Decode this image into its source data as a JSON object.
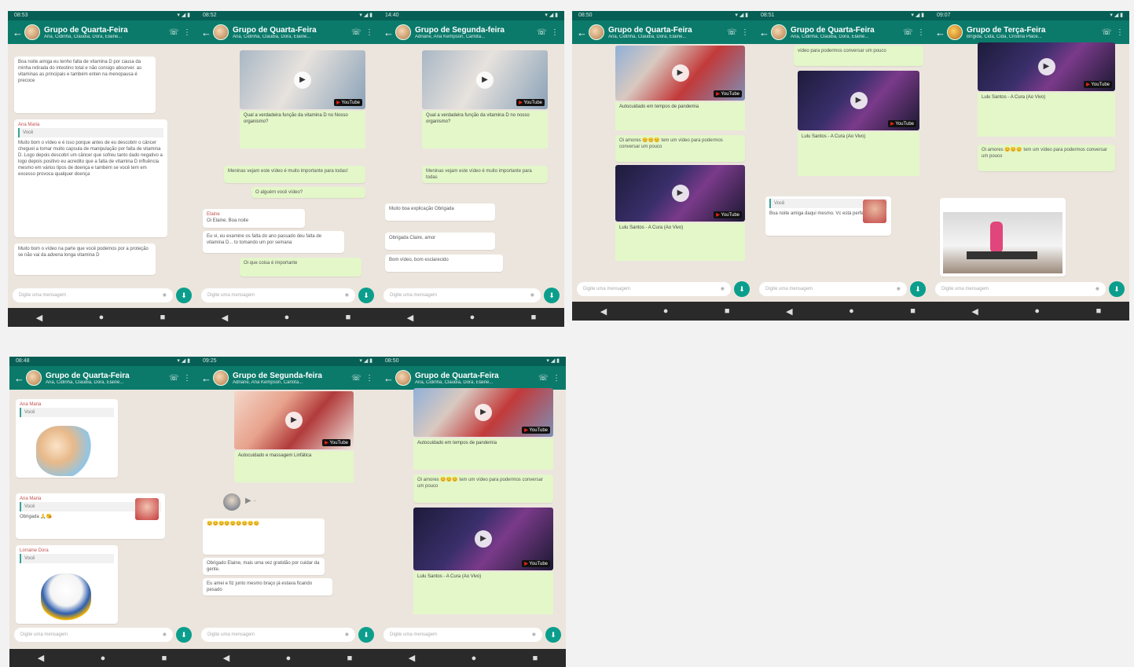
{
  "screens": [
    {
      "time": "08:53",
      "title": "Grupo de Quarta-Feira",
      "subtitle": "Ana, Cidinha, Claudia, Dora, Elaine...",
      "messages": {
        "long_text": "Boa noite amiga eu tenho falta de vitamina D por causa da minha retirada do intestino total e não consigo absorver. as vitaminas as principais e também enten na menopausa é precoce",
        "sender": "Ana Maria",
        "quote_label": "Você",
        "reply": "Muito bom o vídeo e é isso porque antes de eu descobrir o câncer cheguei a tomar muito capsula de manipulação por falta de vitamina D. Logo depois descobri um câncer que sofreu tanto dado negativo a logo depois positivo eu acredito que a falta de vitamina D influência mesmo em vários tipos de doença e também se você tem em excesso provoca qualquer doença",
        "reply2": "Muito bom o vídeo na parte que você podemos por a proteção se não vai da advena longa vitamina D"
      },
      "composer_placeholder": "Digite uma mensagem"
    },
    {
      "time": "08:52",
      "title": "Grupo de Quarta-Feira",
      "subtitle": "Ana, Cidinha, Claudia, Dora, Elaine...",
      "video_caption": "Qual a verdadeira função da vitamina D no Nosso organismo?",
      "out_msg": "Meninas vejam este vídeo é muito importante para todas!",
      "out_msg2": "O alguém você vídeo?",
      "in_sender": "Elaine",
      "in_msg": "Oi Elaine, Boa noite",
      "in_msg2": "Eu vi, eu examine os falta do ano passado deu falta de vitamina D... to tomando um por semana",
      "bottom_out": "Oi que coisa é importante",
      "composer_placeholder": "Digite uma mensagem"
    },
    {
      "time": "14:40",
      "title": "Grupo de Segunda-feira",
      "subtitle": "Adriane, Ana Kempson, Carlota...",
      "video_caption": "Qual a verdadeira função da vitamina D no nosso organismo?",
      "out_msg": "Meninas vejam este vídeo é muito importante para todas",
      "in_msg": "Muito boa explicação Obrigada",
      "in_msg2": "Obrigada Claire, amor",
      "in_msg3": "Bom vídeo, bom esclarecido",
      "composer_placeholder": "Digite uma mensagem"
    },
    {
      "time": "08:50",
      "title": "Grupo de Quarta-Feira",
      "subtitle": "Ana, Cidinha, Claudia, Dora, Elaine...",
      "caption1": "Autocuidado em tempos de pandemia",
      "out_msg": "Oi amores 😊😊😊 tem um vídeo para podermos conversar um pouco",
      "caption2": "Lulu Santos - A Cura (Ao Vivo)",
      "composer_placeholder": "Digite uma mensagem"
    },
    {
      "time": "08:51",
      "title": "Grupo de Quarta-Feira",
      "subtitle": "Ana, Cidinha, Claudia, Dora, Elaine...",
      "out_msg": "vídeo para podermos conversar um pouco",
      "caption": "Lulu Santos - A Cura (Ao Vivo)",
      "in_quote": "Você",
      "in_msg": "Boa noite amiga daqui mesmo. Vc está perfeita",
      "composer_placeholder": "Digite uma mensagem"
    },
    {
      "time": "09:07",
      "title": "Grupo de Terça-Feira",
      "subtitle": "Brígida, Cida, Cida, Cristina Place...",
      "caption": "Lulu Santos - A Cura (Ao Vivo)",
      "out_msg": "Oi amores 😊😊😊 tem um vídeo para podermos conversar um pouco",
      "composer_placeholder": "Digite uma mensagem"
    },
    {
      "time": "08:48",
      "title": "Grupo de Quarta-Feira",
      "subtitle": "Ana, Cidinha, Claudia, Dora, Elaine...",
      "sender1": "Ana Maria",
      "quote1": "Você",
      "sender2": "Ana Maria",
      "quote2": "Você",
      "thanks": "Obrigada 🙏😘",
      "sender3": "Lorraine Dora",
      "quote3": "Você",
      "composer_placeholder": "Digite uma mensagem"
    },
    {
      "time": "09:25",
      "title": "Grupo de Segunda-feira",
      "subtitle": "Adriane, Ana Kempson, Carlota...",
      "caption": "Autocuidado e massagem Linfática",
      "in_emoji": "😊😊😊😊😊😊😊😊😊",
      "in_msg": "Obrigado Elaine, mais uma vez gratidão por cuidar da gente.",
      "in_msg2": "Eu amei e fiz junto mesmo braço já estava ficando pesado",
      "composer_placeholder": "Digite uma mensagem"
    },
    {
      "time": "08:50",
      "title": "Grupo de Quarta-Feira",
      "subtitle": "Ana, Cidinha, Claudia, Dora, Elaine...",
      "caption1": "Autocuidado em tempos de pandemia",
      "out_msg": "Oi amores 😊😊😊 tem um vídeo para podermos conversar um pouco",
      "caption2": "Lulu Santos - A Cura (Ao Vivo)",
      "composer_placeholder": "Digite uma mensagem"
    }
  ],
  "youtube_label": "YouTube"
}
